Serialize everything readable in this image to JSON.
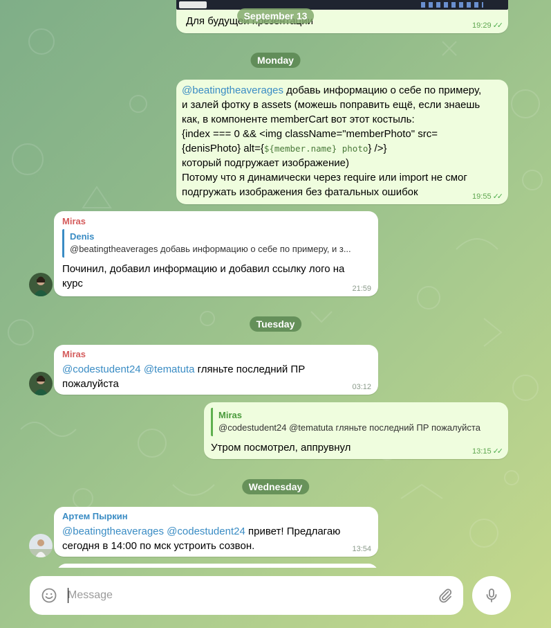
{
  "messages_top": {
    "date_1": "September 13",
    "msg_1_text": "Для будущей презентации",
    "msg_1_time": "19:29"
  },
  "date_monday": "Monday",
  "msg_2": {
    "mention": "@beatingtheaverages",
    "line1_rest": " добавь информацию о себе по примеру,",
    "line2": "и залей фотку в assets (можешь поправить ещё, если знаешь",
    "line3": "как, в компоненте memberCart вот этот костыль:",
    "line4": "{index === 0 && <img className=\"memberPhoto\" src=",
    "line5_pre": "{denisPhoto} alt={",
    "line5_code": "${member.name} photo",
    "line5_post": "} />}",
    "line6": "который подгружает изображение)",
    "line7": "Потому что я динамически через require или import не смог",
    "line8": "подгружать изображения без фатальных ошибок",
    "time": "19:55"
  },
  "msg_3": {
    "sender": "Miras",
    "reply_name": "Denis",
    "reply_text": "@beatingtheaverages добавь информацию о себе по примеру, и з...",
    "line1": "Починил, добавил информацию и добавил ссылку лого на",
    "line2": "курс",
    "time": "21:59"
  },
  "date_tuesday": "Tuesday",
  "msg_4": {
    "sender": "Miras",
    "mention1": "@codestudent24",
    "mention2": "@tematuta",
    "line1_rest": " гляньте последний ПР",
    "line2": "пожалуйста",
    "time": "03:12"
  },
  "msg_5": {
    "reply_name": "Miras",
    "reply_text": "@codestudent24 @tematuta гляньте последний ПР пожалуйста",
    "text": "Утром посмотрел, аппрувнул",
    "time": "13:15"
  },
  "date_wednesday": "Wednesday",
  "msg_6": {
    "sender": "Артем Пыркин",
    "mention1": "@beatingtheaverages",
    "mention2": "@codestudent24",
    "line1_rest": " привет! Предлагаю",
    "line2": "сегодня в 14:00 по мск устроить созвон.",
    "time": "13:54"
  },
  "composer": {
    "placeholder": "Message"
  },
  "icons": {
    "emoji": "smile-icon",
    "attach": "paperclip-icon",
    "mic": "microphone-icon",
    "read": "double-check-icon"
  },
  "colors": {
    "outgoing_bubble": "#effdde",
    "incoming_bubble": "#ffffff",
    "mention": "#3a8cc4",
    "date_pill": "#54824c"
  }
}
